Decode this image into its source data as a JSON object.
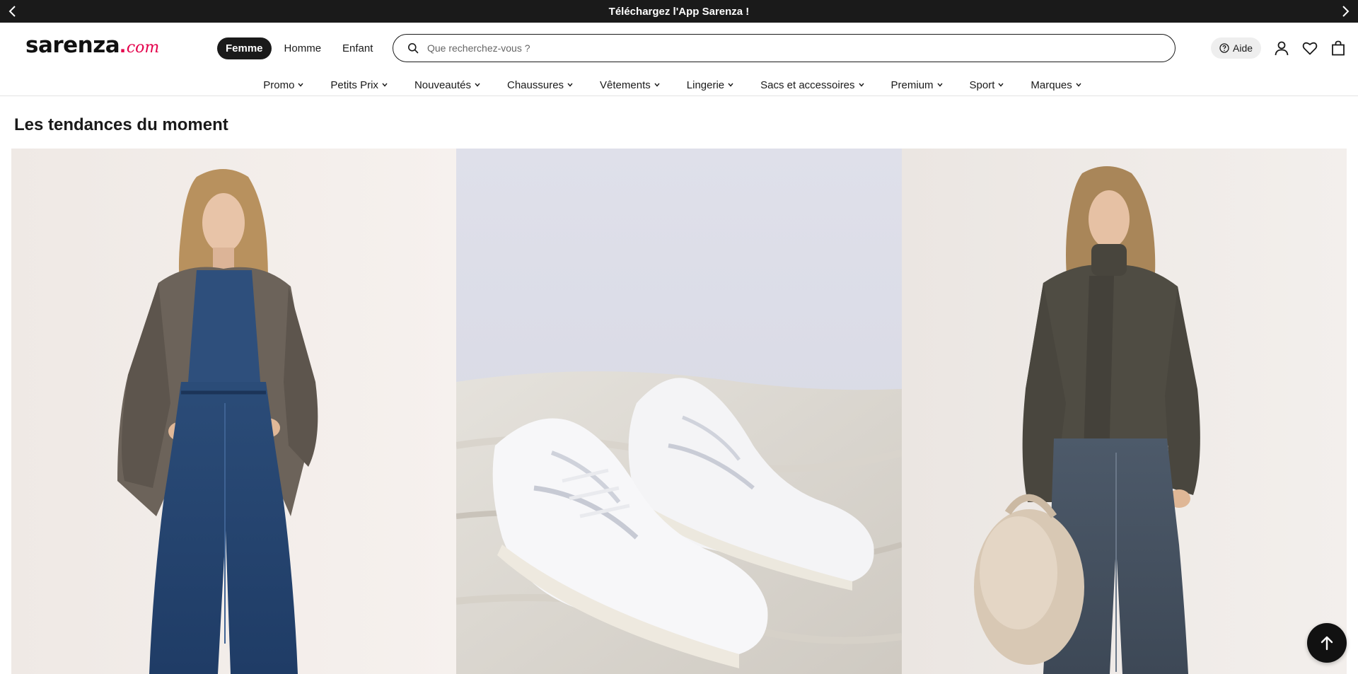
{
  "promo_banner": {
    "text": "Téléchargez l'App Sarenza !",
    "prev_icon": "chevron-left-icon",
    "next_icon": "chevron-right-icon"
  },
  "header": {
    "logo": {
      "main": "sarenza",
      "dot": ".",
      "suffix": "com"
    },
    "gender_tabs": [
      {
        "label": "Femme",
        "active": true
      },
      {
        "label": "Homme",
        "active": false
      },
      {
        "label": "Enfant",
        "active": false
      }
    ],
    "search": {
      "placeholder": "Que recherchez-vous ?",
      "value": "",
      "icon": "search-icon"
    },
    "help": {
      "label": "Aide",
      "icon": "help-circle-icon"
    },
    "icons": [
      "user-icon",
      "heart-icon",
      "shopping-bag-icon"
    ]
  },
  "nav": {
    "items": [
      "Promo",
      "Petits Prix",
      "Nouveautés",
      "Chaussures",
      "Vêtements",
      "Lingerie",
      "Sacs et accessoires",
      "Premium",
      "Sport",
      "Marques"
    ]
  },
  "main": {
    "section_title": "Les tendances du moment",
    "tiles": [
      {
        "subject": "woman-blazer-denim",
        "bg": "#f2ede9"
      },
      {
        "subject": "white-sneakers",
        "bg": "#dcdde7"
      },
      {
        "subject": "woman-knit-scarf",
        "bg": "#efebe7"
      }
    ]
  },
  "back_to_top": {
    "icon": "arrow-up-icon"
  },
  "colors": {
    "dark": "#1a1a1a",
    "brand_pink": "#e4004b",
    "pill_bg": "#eeeeee"
  }
}
